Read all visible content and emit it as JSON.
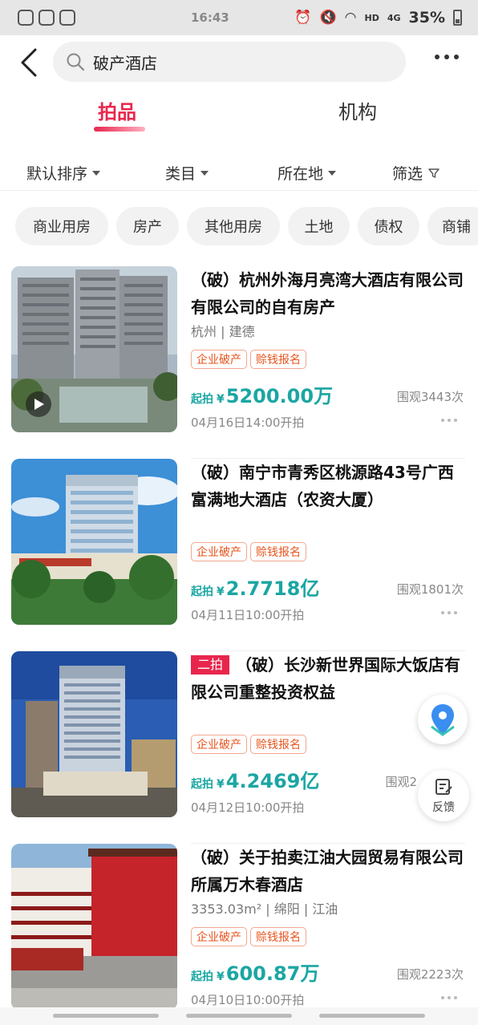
{
  "status": {
    "time": "16:43",
    "battery": "35%",
    "hd": "HD",
    "net": "4G"
  },
  "search": {
    "query": "破产酒店"
  },
  "tabs": [
    {
      "label": "拍品"
    },
    {
      "label": "机构"
    }
  ],
  "filters": [
    {
      "label": "默认排序"
    },
    {
      "label": "类目"
    },
    {
      "label": "所在地"
    },
    {
      "label": "筛选"
    }
  ],
  "chips": [
    {
      "label": "商业用房"
    },
    {
      "label": "房产"
    },
    {
      "label": "其他用房"
    },
    {
      "label": "土地"
    },
    {
      "label": "债权"
    },
    {
      "label": "商铺"
    }
  ],
  "items": [
    {
      "round": "",
      "title": "（破）杭州外海月亮湾大酒店有限公司有限公司的自有房产",
      "location": "杭州 | 建德",
      "tags": [
        "企业破产",
        "赊钱报名"
      ],
      "price_label": "起拍",
      "currency": "¥",
      "price": "5200.00万",
      "views": "围观3443次",
      "time": "04月16日14:00开拍"
    },
    {
      "round": "",
      "title": "（破）南宁市青秀区桃源路43号广西富满地大酒店（农资大厦）",
      "location": "",
      "tags": [
        "企业破产",
        "赊钱报名"
      ],
      "price_label": "起拍",
      "currency": "¥",
      "price": "2.7718亿",
      "views": "围观1801次",
      "time": "04月11日10:00开拍"
    },
    {
      "round": "二拍",
      "title": "（破）长沙新世界国际大饭店有限公司重整投资权益",
      "location": "",
      "tags": [
        "企业破产",
        "赊钱报名"
      ],
      "price_label": "起拍",
      "currency": "¥",
      "price": "4.2469亿",
      "views": "围观2",
      "time": "04月12日10:00开拍"
    },
    {
      "round": "",
      "title": "（破）关于拍卖江油大园贸易有限公司所属万木春酒店",
      "location": "3353.03m² | 绵阳 | 江油",
      "tags": [
        "企业破产",
        "赊钱报名"
      ],
      "price_label": "起拍",
      "currency": "¥",
      "price": "600.87万",
      "views": "围观2223次",
      "time": "04月10日10:00开拍"
    }
  ],
  "feedback": {
    "label": "反馈"
  },
  "colors": {
    "accent": "#e8264d",
    "price": "#1ba6a3",
    "tag": "#e8541d"
  }
}
